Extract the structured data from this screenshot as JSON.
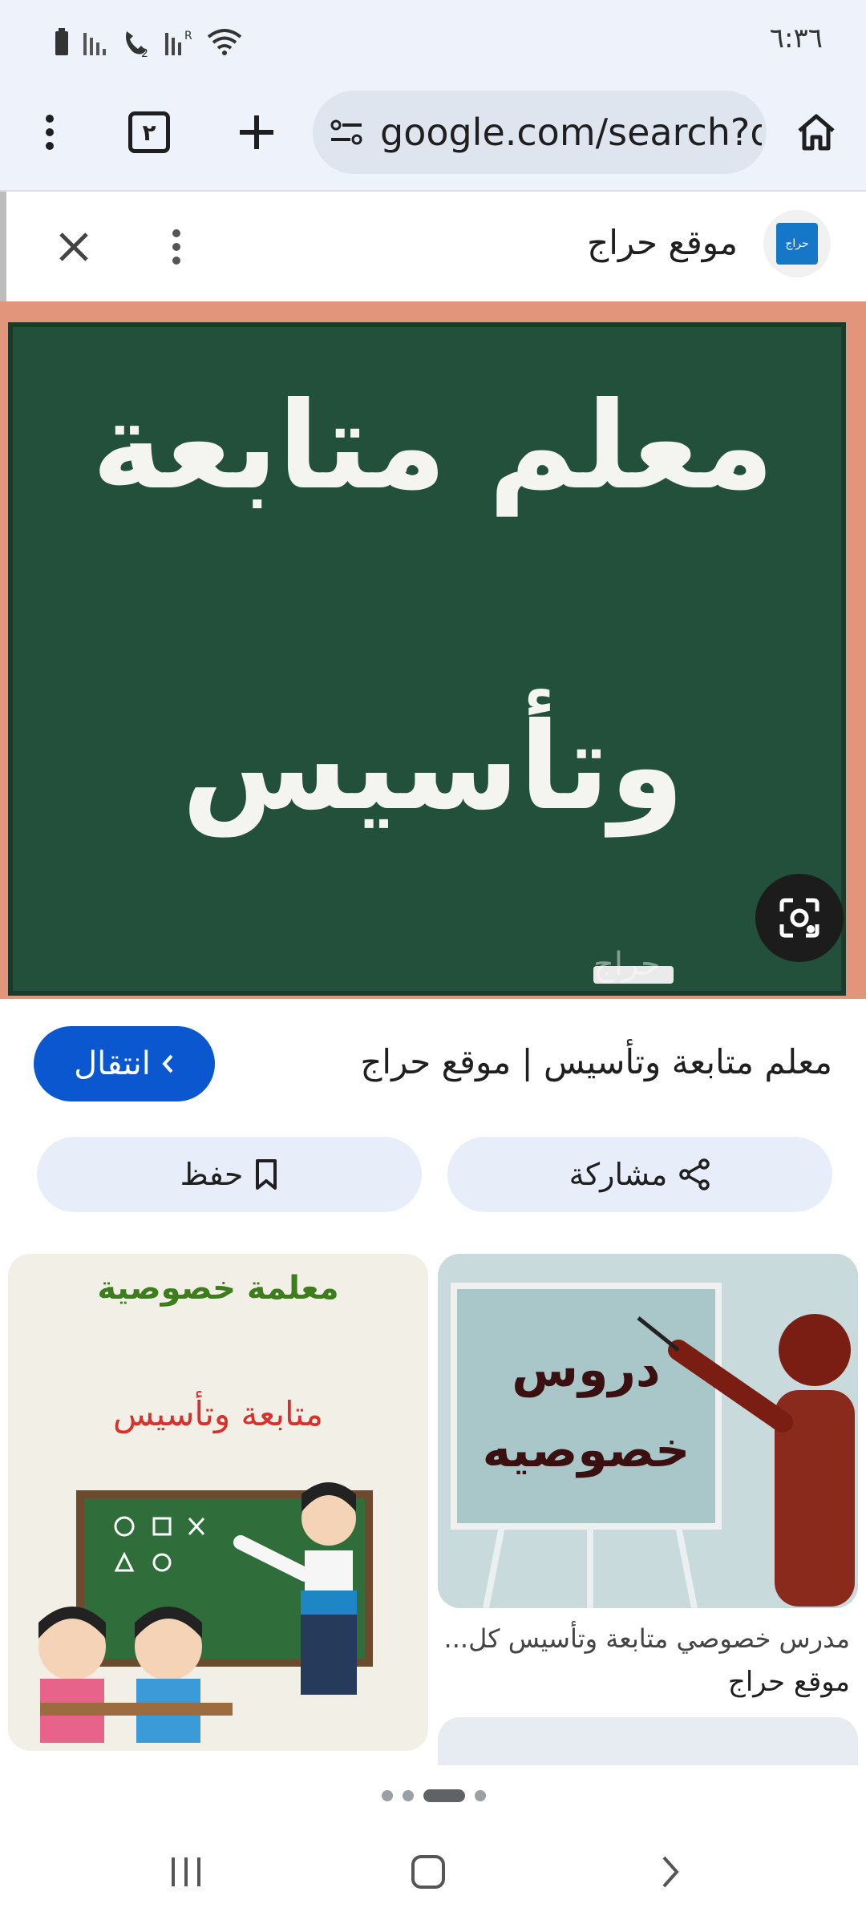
{
  "status_bar": {
    "time": "٦:٣٦",
    "icons": [
      "battery-icon",
      "signal-icon",
      "wifi-calling-icon",
      "signal-roaming-icon",
      "wifi-icon"
    ]
  },
  "toolbar": {
    "url": "google.com/search?q=",
    "tab_count": "٢",
    "icons": [
      "menu-dots-icon",
      "tabs-icon",
      "new-tab-icon",
      "site-info-icon",
      "home-icon"
    ]
  },
  "sheet": {
    "source_name": "موقع حراج",
    "favicon_text": "حراج",
    "image": {
      "line1": "معلم متابعة",
      "line2": "وتأسيس",
      "watermark": "حراج"
    },
    "result_title": "معلم متابعة وتأسيس | موقع حراج",
    "visit_label": "انتقال",
    "share_label": "مشاركة",
    "save_label": "حفظ"
  },
  "related": {
    "right": {
      "image_text_1": "دروس",
      "image_text_2": "خصوصيه",
      "caption": "مدرس خصوصي متابعة وتأسيس كل...",
      "source": "موقع حراج"
    },
    "left": {
      "image_text_1": "معلمة خصوصية",
      "image_text_2": "متابعة وتأسيس"
    }
  },
  "pager": {
    "count": 4,
    "active": 2
  },
  "colors": {
    "accent": "#0b57d0",
    "toolbar_bg": "#eef3fb",
    "chalkboard": "#22503a",
    "board_frame": "#e3957c"
  }
}
